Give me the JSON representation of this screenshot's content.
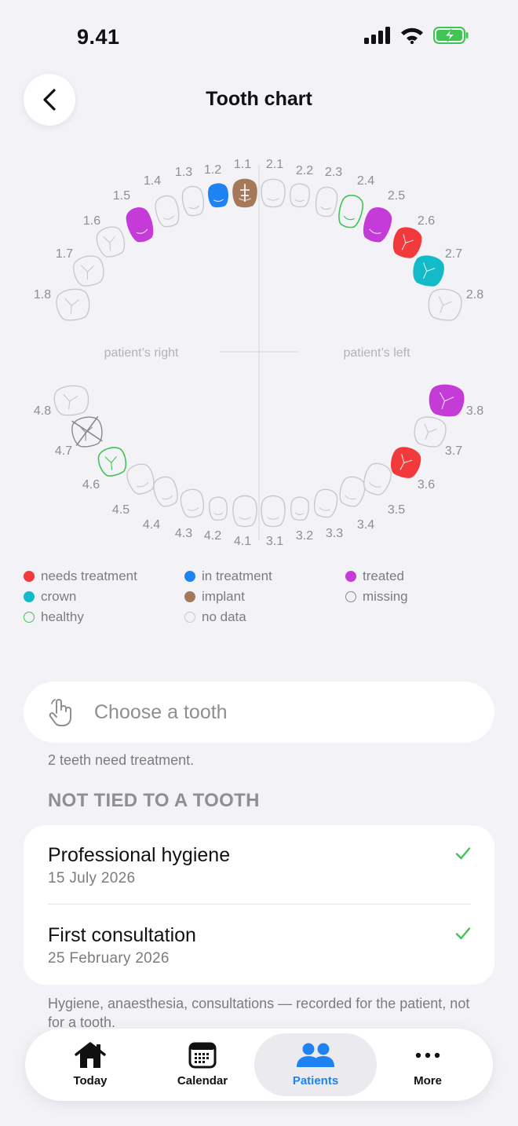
{
  "status": {
    "time": "9.41"
  },
  "header": {
    "title": "Tooth chart"
  },
  "chart": {
    "side_right": "patient’s right",
    "side_left": "patient’s left",
    "colors": {
      "needs_treatment": "#f2393b",
      "in_treatment": "#1f82f2",
      "treated": "#c43bd8",
      "crown": "#13bac8",
      "implant": "#a6785a",
      "healthy": "#3fc552",
      "no_data": "#c9c9cd",
      "missing": "#8b8b8f"
    },
    "teeth": [
      {
        "id": "1.8",
        "status": "no_data"
      },
      {
        "id": "1.7",
        "status": "no_data"
      },
      {
        "id": "1.6",
        "status": "no_data"
      },
      {
        "id": "1.5",
        "status": "treated"
      },
      {
        "id": "1.4",
        "status": "no_data"
      },
      {
        "id": "1.3",
        "status": "no_data"
      },
      {
        "id": "1.2",
        "status": "in_treatment"
      },
      {
        "id": "1.1",
        "status": "implant"
      },
      {
        "id": "2.1",
        "status": "no_data"
      },
      {
        "id": "2.2",
        "status": "no_data"
      },
      {
        "id": "2.3",
        "status": "no_data"
      },
      {
        "id": "2.4",
        "status": "healthy"
      },
      {
        "id": "2.5",
        "status": "treated"
      },
      {
        "id": "2.6",
        "status": "needs_treatment"
      },
      {
        "id": "2.7",
        "status": "crown"
      },
      {
        "id": "2.8",
        "status": "no_data"
      },
      {
        "id": "4.8",
        "status": "no_data"
      },
      {
        "id": "4.7",
        "status": "missing"
      },
      {
        "id": "4.6",
        "status": "healthy"
      },
      {
        "id": "4.5",
        "status": "no_data"
      },
      {
        "id": "4.4",
        "status": "no_data"
      },
      {
        "id": "4.3",
        "status": "no_data"
      },
      {
        "id": "4.2",
        "status": "no_data"
      },
      {
        "id": "4.1",
        "status": "no_data"
      },
      {
        "id": "3.1",
        "status": "no_data"
      },
      {
        "id": "3.2",
        "status": "no_data"
      },
      {
        "id": "3.3",
        "status": "no_data"
      },
      {
        "id": "3.4",
        "status": "no_data"
      },
      {
        "id": "3.5",
        "status": "no_data"
      },
      {
        "id": "3.6",
        "status": "needs_treatment"
      },
      {
        "id": "3.7",
        "status": "no_data"
      },
      {
        "id": "3.8",
        "status": "treated"
      }
    ]
  },
  "legend": [
    {
      "label": "needs treatment",
      "status": "needs_treatment",
      "filled": true
    },
    {
      "label": "in treatment",
      "status": "in_treatment",
      "filled": true
    },
    {
      "label": "treated",
      "status": "treated",
      "filled": true
    },
    {
      "label": "crown",
      "status": "crown",
      "filled": true
    },
    {
      "label": "implant",
      "status": "implant",
      "filled": true
    },
    {
      "label": "missing",
      "status": "missing",
      "filled": false
    },
    {
      "label": "healthy",
      "status": "healthy",
      "filled": false
    },
    {
      "label": "no data",
      "status": "no_data",
      "filled": false
    }
  ],
  "tooth_picker": {
    "label": "Choose a tooth"
  },
  "treatment_note": "2 teeth need treatment.",
  "section": {
    "title": "NOT TIED TO A TOOTH"
  },
  "visits": [
    {
      "title": "Professional hygiene",
      "date": "15 July 2026"
    },
    {
      "title": "First consultation",
      "date": "25 February 2026"
    }
  ],
  "footnote": "Hygiene, anaesthesia, consultations — recorded for the patient, not for a tooth.",
  "tabs": [
    {
      "label": "Today",
      "icon": "house-icon"
    },
    {
      "label": "Calendar",
      "icon": "calendar-icon"
    },
    {
      "label": "Patients",
      "icon": "patients-icon",
      "active": true
    },
    {
      "label": "More",
      "icon": "more-icon"
    }
  ]
}
